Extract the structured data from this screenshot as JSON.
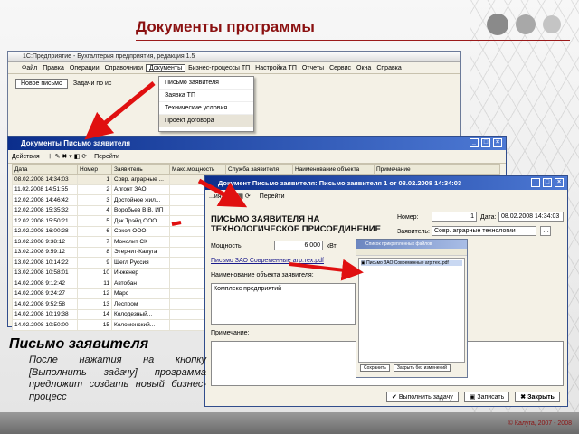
{
  "slide": {
    "title": "Документы программы",
    "copyright": "© Калуга, 2007 - 2008",
    "accent_color": "#8b1111"
  },
  "main_window": {
    "title": "1С:Предприятие - Бухгалтерия предприятия, редакция 1.5",
    "menu": [
      "Файл",
      "Правка",
      "Операции",
      "Справочники",
      "Документы",
      "Бизнес-процессы ТП",
      "Настройка ТП",
      "Отчеты",
      "Сервис",
      "Окна",
      "Справка"
    ],
    "toolbar": {
      "new_letter": "Новое письмо",
      "tasks": "Задачи по ис"
    }
  },
  "documents_menu": {
    "items": [
      "Письмо заявителя",
      "Заявка ТП",
      "Технические условия",
      "Проект договора"
    ]
  },
  "docs_window": {
    "title": "Документы Письмо заявителя",
    "toolbar": {
      "actions": "Действия",
      "goto": "Перейти"
    },
    "columns": [
      "Дата",
      "Номер",
      "Заявитель",
      "Макс.мощность",
      "Служба заявителя",
      "Наименование объекта",
      "Примечание"
    ],
    "rows": [
      [
        "08.02.2008 14:34:03",
        "1",
        "Совр. аграрные ..."
      ],
      [
        "11.02.2008 14:51:55",
        "2",
        "Алгонт ЗАО"
      ],
      [
        "12.02.2008 14:46:42",
        "3",
        "Достойное жил..."
      ],
      [
        "12.02.2008 15:35:32",
        "4",
        "Воробьев В.В. ИП"
      ],
      [
        "12.02.2008 15:50:21",
        "5",
        "Дэк Трэйд ООО"
      ],
      [
        "12.02.2008 16:00:28",
        "6",
        "Сокол ООО"
      ],
      [
        "13.02.2008 9:38:12",
        "7",
        "Монолит СК"
      ],
      [
        "13.02.2008 9:59:12",
        "8",
        "Этернит-Калуга"
      ],
      [
        "13.02.2008 10:14:22",
        "9",
        "Щегл Руссия"
      ],
      [
        "13.02.2008 10:58:01",
        "10",
        "Инженер"
      ],
      [
        "14.02.2008 9:12:42",
        "11",
        "Автобан"
      ],
      [
        "14.02.2008 9:24:27",
        "12",
        "Марс"
      ],
      [
        "14.02.2008 9:52:58",
        "13",
        "Леспром"
      ],
      [
        "14.02.2008 10:19:38",
        "14",
        "Колодезный..."
      ],
      [
        "14.02.2008 10:50:00",
        "15",
        "Коломенский..."
      ]
    ]
  },
  "letter_window": {
    "title": "Документ Письмо заявителя: Письмо заявителя 1 от 08.02.2008 14:34:03",
    "toolbar": {
      "actions": "...ия",
      "goto": "Перейти"
    },
    "heading": "ПИСЬМО ЗАЯВИТЕЛЯ НА ТЕХНОЛОГИЧЕСКОЕ ПРИСОЕДИНЕНИЕ",
    "number_label": "Номер:",
    "number_value": "1",
    "date_label": "Дата:",
    "date_value": "08.02.2008 14:34:03",
    "applicant_label": "Заявитель:",
    "applicant_value": "Совр. аграрные технологии",
    "power_label": "Мощность:",
    "power_value": "6 000",
    "power_unit": "кВт",
    "file_link": "Письмо ЗАО Современные агр.тех.pdf",
    "object_label": "Наименование объекта заявителя:",
    "object_value": "Комплекс предприятий",
    "notes_label": "Примечание:",
    "buttons": {
      "execute": "Выполнить задачу",
      "save": "Записать",
      "close": "Закрыть"
    }
  },
  "file_dialog": {
    "title": "Список прикрепленных файлов",
    "file": "Письмо ЗАО Современные агр.тех..pdf",
    "ok": "Сохранить",
    "close": "Закрыть без изменений"
  },
  "note": {
    "heading": "Письмо заявителя",
    "text": "После нажатия на кнопку [Выполнить задачу] программа предложит создать новый бизнес-процесс"
  }
}
